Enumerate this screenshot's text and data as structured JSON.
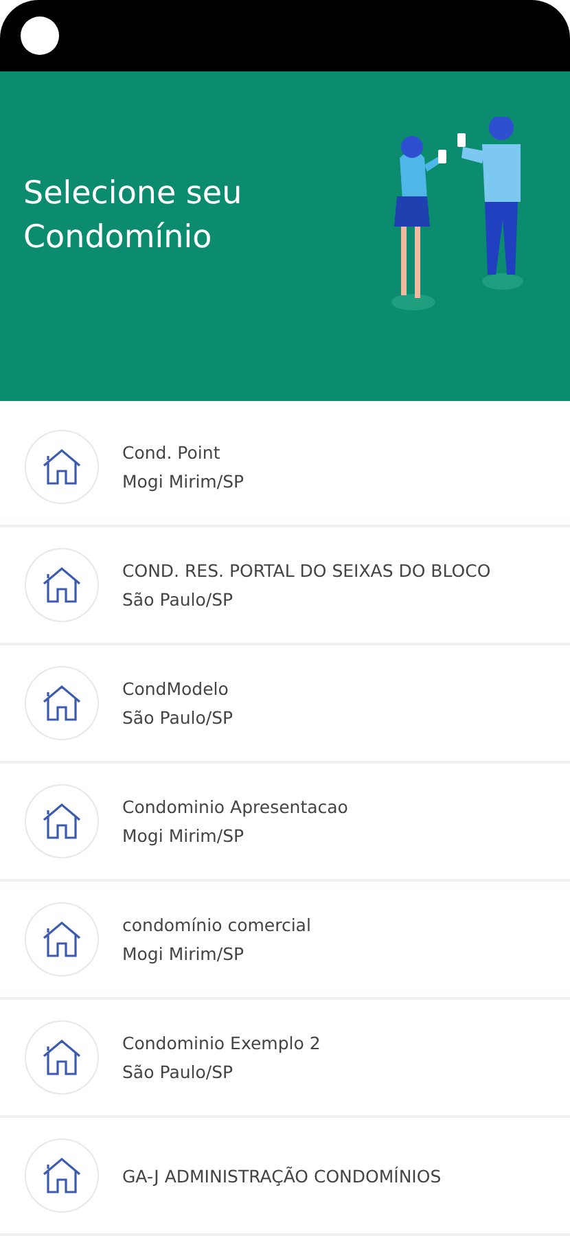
{
  "header": {
    "title": "Selecione seu Condomínio"
  },
  "condominiums": [
    {
      "name": "Cond. Point",
      "city": "Mogi Mirim/SP"
    },
    {
      "name": "COND. RES. PORTAL DO SEIXAS DO BLOCO",
      "city": "São Paulo/SP"
    },
    {
      "name": "CondModelo",
      "city": "São Paulo/SP"
    },
    {
      "name": "Condominio Apresentacao",
      "city": "Mogi Mirim/SP"
    },
    {
      "name": "condomínio comercial",
      "city": "Mogi Mirim/SP"
    },
    {
      "name": "Condominio Exemplo 2",
      "city": "São Paulo/SP"
    },
    {
      "name": "GA-J ADMINISTRAÇÃO CONDOMÍNIOS"
    }
  ]
}
